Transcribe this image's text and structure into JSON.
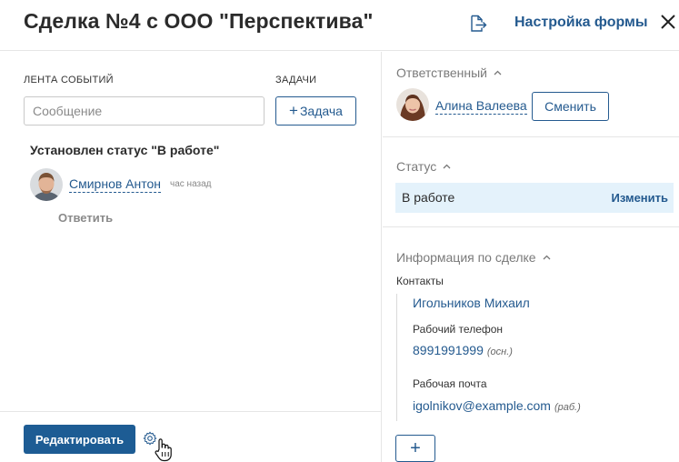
{
  "header": {
    "title": "Сделка №4 с ООО \"Перспектива\"",
    "form_settings_label": "Настройка формы"
  },
  "feed": {
    "feed_caption": "ЛЕНТА СОБЫТИЙ",
    "tasks_caption": "ЗАДАЧИ",
    "message_placeholder": "Сообщение",
    "task_button_plus": "+",
    "task_button_label": "Задача",
    "event": {
      "title": "Установлен статус \"В работе\"",
      "author": "Смирнов Антон",
      "time": "час назад",
      "reply_label": "Ответить"
    }
  },
  "footer": {
    "edit_label": "Редактировать"
  },
  "sidebar": {
    "responsible": {
      "title": "Ответственный",
      "name": "Алина Валеева",
      "change_label": "Сменить"
    },
    "status": {
      "title": "Статус",
      "value": "В работе",
      "change_label": "Изменить"
    },
    "deal_info": {
      "title": "Информация по сделке",
      "contacts_label": "Контакты",
      "contact_name": "Игольников Михаил",
      "phone_label": "Рабочий телефон",
      "phone_value": "8991991999",
      "phone_tag": "(осн.)",
      "email_label": "Рабочая почта",
      "email_value": "igolnikov@example.com",
      "email_tag": "(раб.)",
      "add_label": "+"
    }
  },
  "icons": {
    "export": "export-icon",
    "close": "close-icon",
    "gear": "gear-icon",
    "cursor": "hand-cursor-icon",
    "caret": "chevron-up-icon"
  },
  "colors": {
    "accent": "#245a8f",
    "primary_button": "#1d5c94",
    "status_highlight": "#e4f2fb",
    "divider": "#e6e6e6"
  }
}
